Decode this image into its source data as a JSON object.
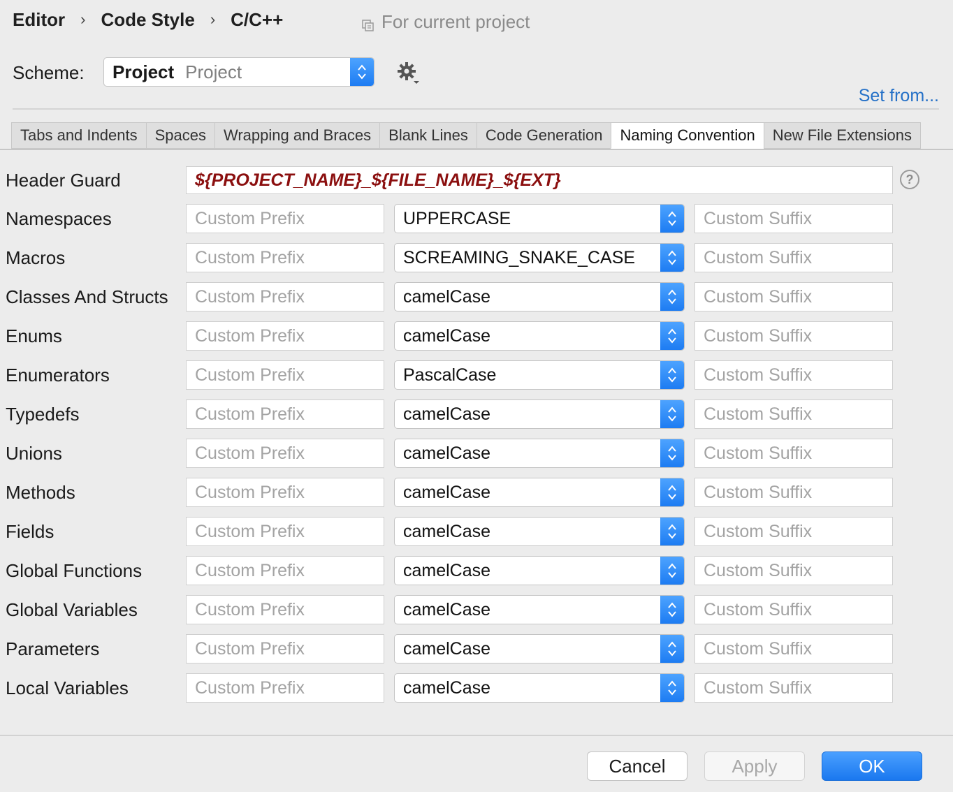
{
  "breadcrumb": {
    "items": [
      "Editor",
      "Code Style",
      "C/C++"
    ],
    "separator": "›"
  },
  "project_hint": "For current project",
  "scheme": {
    "label": "Scheme:",
    "name": "Project",
    "kind": "Project"
  },
  "set_from": "Set from...",
  "tabs": [
    {
      "label": "Tabs and Indents",
      "active": false
    },
    {
      "label": "Spaces",
      "active": false
    },
    {
      "label": "Wrapping and Braces",
      "active": false
    },
    {
      "label": "Blank Lines",
      "active": false
    },
    {
      "label": "Code Generation",
      "active": false
    },
    {
      "label": "Naming Convention",
      "active": true
    },
    {
      "label": "New File Extensions",
      "active": false
    }
  ],
  "header_guard": {
    "label": "Header Guard",
    "value": "${PROJECT_NAME}_${FILE_NAME}_${EXT}",
    "help": "?"
  },
  "placeholders": {
    "prefix": "Custom Prefix",
    "suffix": "Custom Suffix"
  },
  "rows": [
    {
      "label": "Namespaces",
      "case": "UPPERCASE"
    },
    {
      "label": "Macros",
      "case": "SCREAMING_SNAKE_CASE"
    },
    {
      "label": "Classes And Structs",
      "case": "camelCase"
    },
    {
      "label": "Enums",
      "case": "camelCase"
    },
    {
      "label": "Enumerators",
      "case": "PascalCase"
    },
    {
      "label": "Typedefs",
      "case": "camelCase"
    },
    {
      "label": "Unions",
      "case": "camelCase"
    },
    {
      "label": "Methods",
      "case": "camelCase"
    },
    {
      "label": "Fields",
      "case": "camelCase"
    },
    {
      "label": "Global Functions",
      "case": "camelCase"
    },
    {
      "label": "Global Variables",
      "case": "camelCase"
    },
    {
      "label": "Parameters",
      "case": "camelCase"
    },
    {
      "label": "Local Variables",
      "case": "camelCase"
    }
  ],
  "buttons": {
    "cancel": "Cancel",
    "apply": "Apply",
    "ok": "OK"
  },
  "colors": {
    "accent": "#1d7cf2",
    "header_guard_text": "#8b0f0f",
    "link": "#2470c7"
  }
}
